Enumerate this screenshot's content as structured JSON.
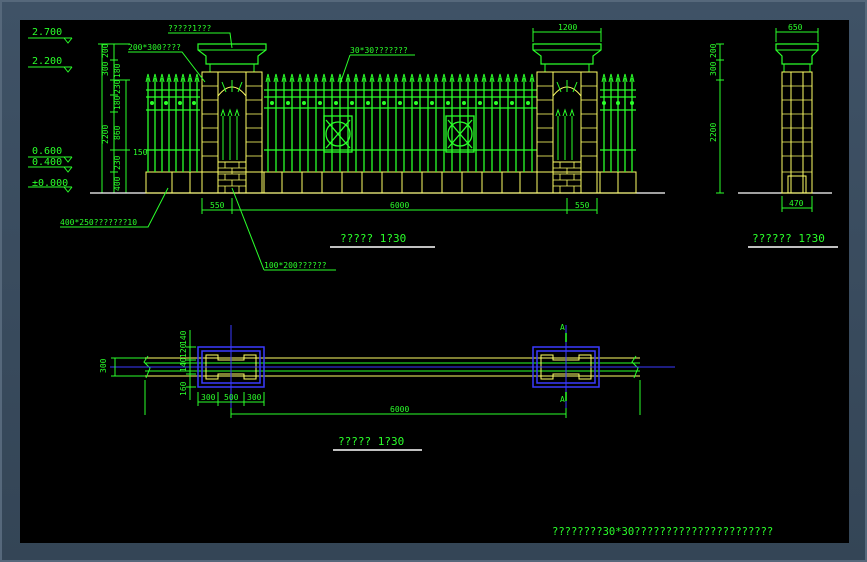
{
  "drawing": {
    "elevation_labels": {
      "lv_2700": "2.700",
      "lv_2200": "2.200",
      "lv_0600": "0.600",
      "lv_0400": "0.400",
      "lv_0000": "±0.000"
    },
    "callouts": {
      "cap_note": "?????1???",
      "stone_note": "200*300????",
      "bar_note": "30*30???????",
      "base_note": "400*250???????10",
      "brick_note": "100*200??????"
    },
    "left_vertical_dims": [
      "200",
      "300",
      "180",
      "230",
      "180",
      "2200",
      "860",
      "150",
      "230",
      "400"
    ],
    "horizontal_dims": {
      "top_pillar_width": "1200",
      "bottom_left": "550",
      "bottom_mid": "6000",
      "bottom_right": "550"
    },
    "side_view_dims": {
      "top_width": "650",
      "bottom_width": "470",
      "v_top": "200",
      "v_300": "300",
      "v_total": "2200"
    },
    "plan_dims": {
      "side_total": "300",
      "v_140a": "140",
      "v_120": "120",
      "v_140b": "140",
      "v_160": "160",
      "seg_300a": "300",
      "seg_500": "500",
      "seg_300b": "300",
      "span_6000": "6000",
      "section_a_top": "A",
      "section_a_bottom": "A"
    },
    "titles": {
      "elevation_title": "?????   1?30",
      "side_title": "??????   1?30",
      "plan_title": "?????   1?30"
    },
    "note": "????????30*30??????????????????????"
  },
  "colors": {
    "background": "#000000",
    "green": "#2aff2a",
    "yellow": "#ffff66",
    "white": "#ffffff",
    "blue": "#3a3aff",
    "cyan": "#00e5ff",
    "frame": "#3f5266"
  }
}
